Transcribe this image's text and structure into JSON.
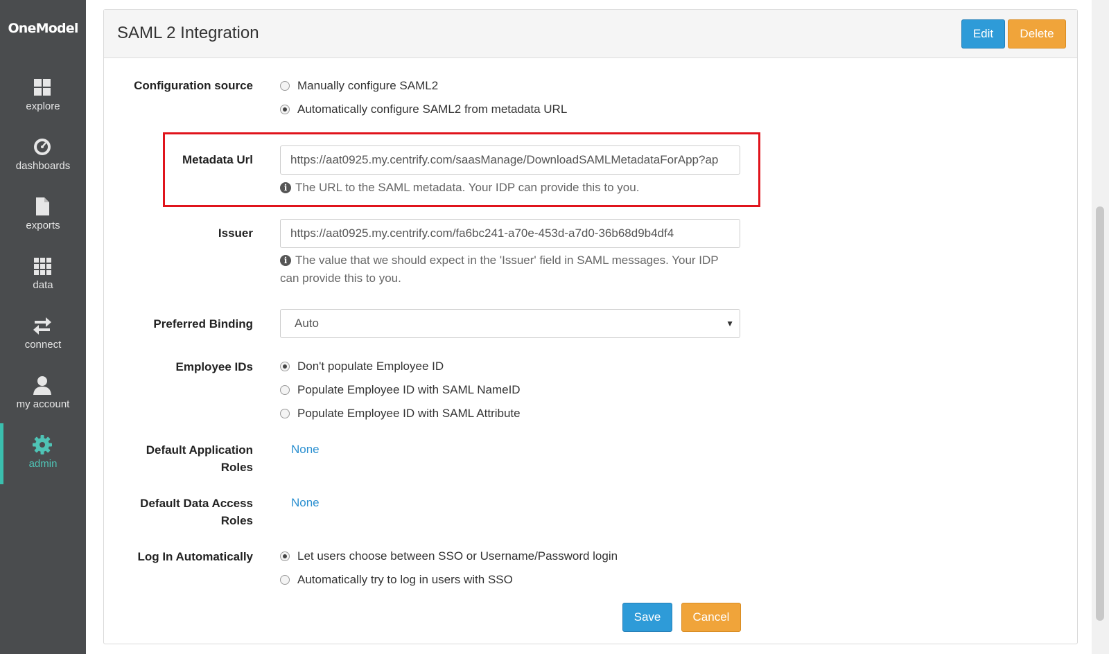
{
  "sidebar": {
    "logo": "OneModel",
    "items": [
      {
        "label": "explore",
        "icon": "grid-icon"
      },
      {
        "label": "dashboards",
        "icon": "gauge-icon"
      },
      {
        "label": "exports",
        "icon": "file-icon"
      },
      {
        "label": "data",
        "icon": "dots-grid-icon"
      },
      {
        "label": "connect",
        "icon": "arrows-swap-icon"
      },
      {
        "label": "my account",
        "icon": "user-icon"
      },
      {
        "label": "admin",
        "icon": "gear-icon",
        "active": true
      }
    ]
  },
  "header": {
    "title": "SAML 2 Integration",
    "edit_label": "Edit",
    "delete_label": "Delete"
  },
  "form": {
    "config_source": {
      "label": "Configuration source",
      "options": [
        {
          "label": "Manually configure SAML2",
          "checked": false
        },
        {
          "label": "Automatically configure SAML2 from metadata URL",
          "checked": true
        }
      ]
    },
    "metadata_url": {
      "label": "Metadata Url",
      "value": "https://aat0925.my.centrify.com/saasManage/DownloadSAMLMetadataForApp?ap",
      "help": "The URL to the SAML metadata. Your IDP can provide this to you."
    },
    "issuer": {
      "label": "Issuer",
      "value": "https://aat0925.my.centrify.com/fa6bc241-a70e-453d-a7d0-36b68d9b4df4",
      "help": "The value that we should expect in the 'Issuer' field in SAML messages. Your IDP can provide this to you."
    },
    "preferred_binding": {
      "label": "Preferred Binding",
      "value": "Auto"
    },
    "employee_ids": {
      "label": "Employee IDs",
      "options": [
        {
          "label": "Don't populate Employee ID",
          "checked": true
        },
        {
          "label": "Populate Employee ID with SAML NameID",
          "checked": false
        },
        {
          "label": "Populate Employee ID with SAML Attribute",
          "checked": false
        }
      ]
    },
    "default_app_roles": {
      "label_line1": "Default Application",
      "label_line2": "Roles",
      "value": "None"
    },
    "default_data_roles": {
      "label_line1": "Default Data Access",
      "label_line2": "Roles",
      "value": "None"
    },
    "log_in_auto": {
      "label": "Log In Automatically",
      "options": [
        {
          "label": "Let users choose between SSO or Username/Password login",
          "checked": true
        },
        {
          "label": "Automatically try to log in users with SSO",
          "checked": false
        }
      ]
    },
    "save_label": "Save",
    "cancel_label": "Cancel"
  },
  "colors": {
    "sidebar_bg": "#4a4c4e",
    "active_accent": "#3bbfae",
    "primary_button": "#2e9bd8",
    "warning_button": "#f0a43a",
    "highlight_box": "#e0141c",
    "link": "#2a8fd0"
  }
}
